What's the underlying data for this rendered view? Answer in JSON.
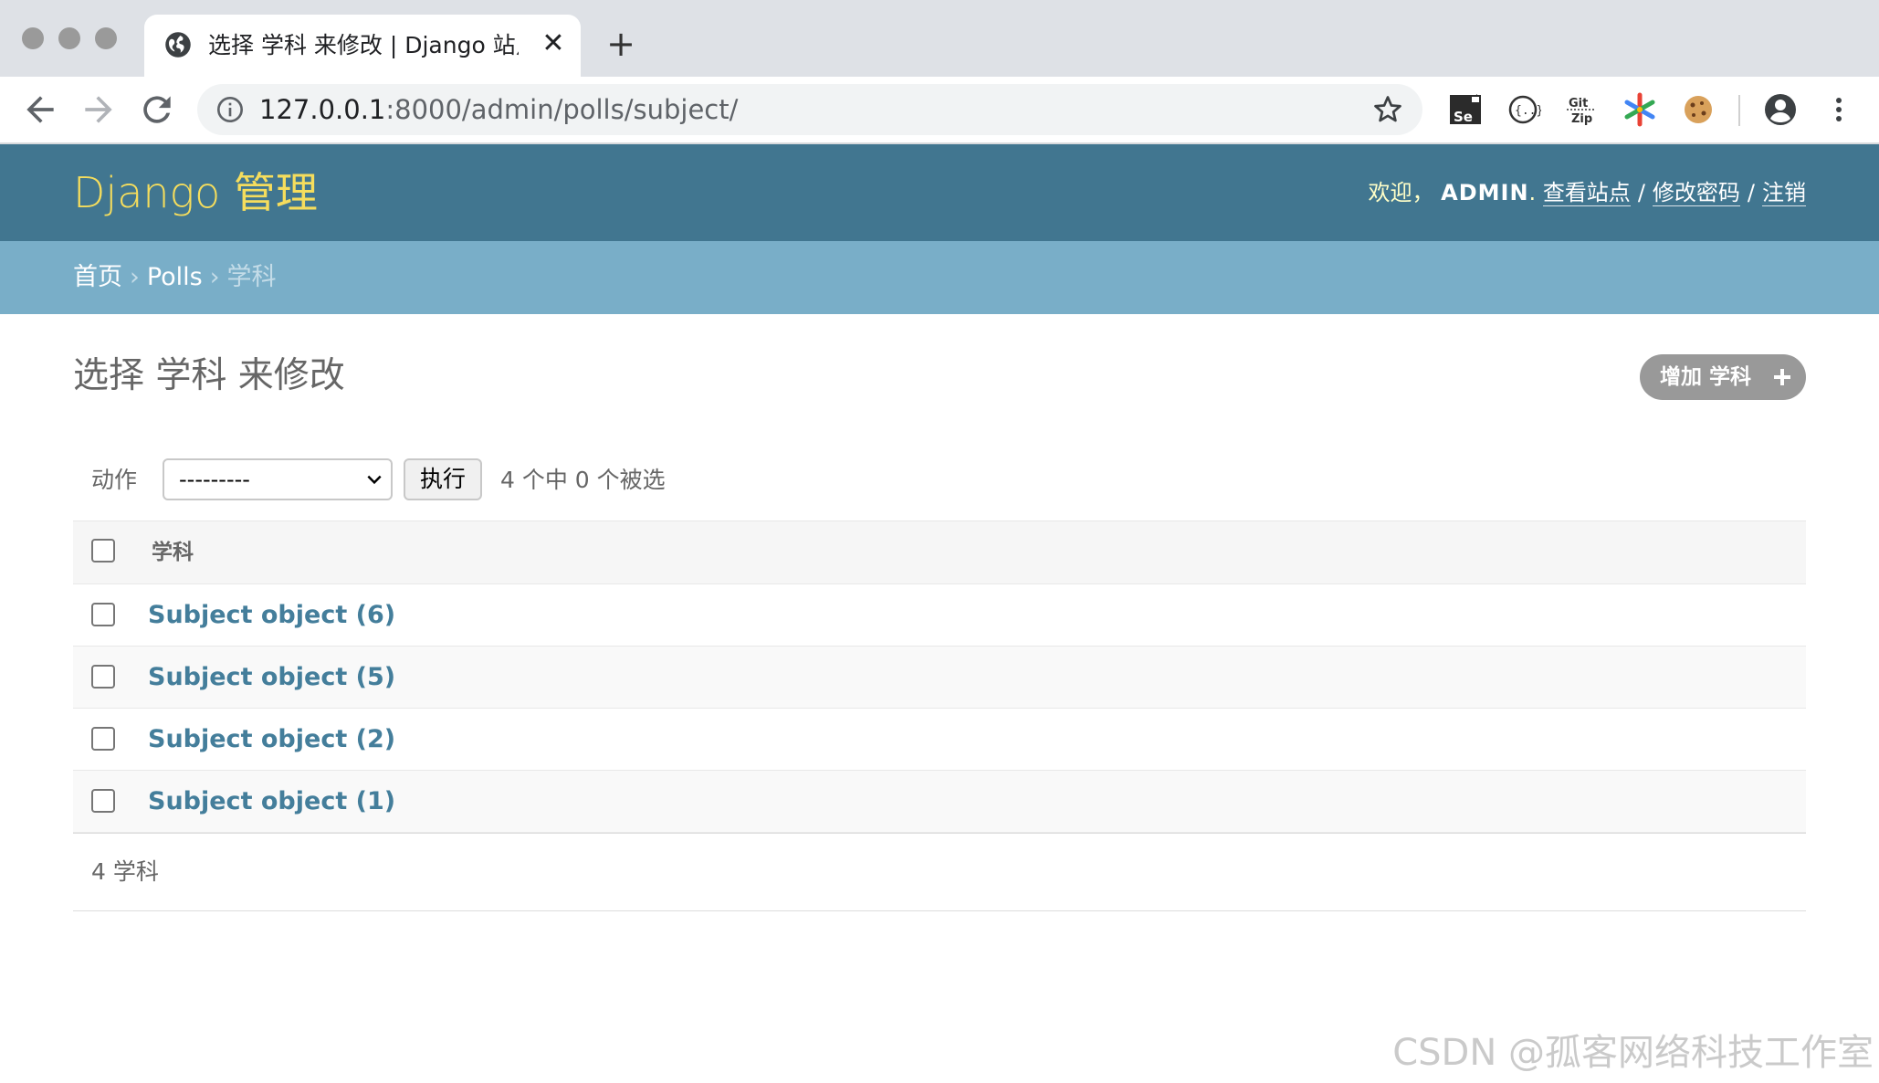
{
  "browser": {
    "tab_title": "选择 学科 来修改 | Django 站点管理",
    "tab_close": "✕",
    "new_tab": "+",
    "url_host": "127.0.0.1",
    "url_path": ":8000/admin/polls/subject/",
    "extensions": [
      "selenium-ide-icon",
      "json-formatter-icon",
      "gitzip-icon",
      "tab-extension-icon",
      "cookie-icon"
    ]
  },
  "header": {
    "brand": "Django 管理",
    "welcome": "欢迎，",
    "username": "ADMIN",
    "view_site": "查看站点",
    "change_password": "修改密码",
    "logout": "注销"
  },
  "breadcrumbs": {
    "home": "首页",
    "app": "Polls",
    "current": "学科"
  },
  "main": {
    "title": "选择 学科 来修改",
    "add_button": "增加 学科",
    "action_label": "动作",
    "action_select_value": "---------",
    "go_button": "执行",
    "selection_counter": "4 个中 0 个被选",
    "column_header": "学科",
    "rows": [
      {
        "label": "Subject object (6)"
      },
      {
        "label": "Subject object (5)"
      },
      {
        "label": "Subject object (2)"
      },
      {
        "label": "Subject object (1)"
      }
    ],
    "paginator": "4 学科"
  },
  "colors": {
    "header_bg": "#417690",
    "breadcrumb_bg": "#79aec8",
    "brand_text": "#f5dd5d",
    "link": "#447e9b",
    "add_button_bg": "#999999"
  },
  "watermark": "CSDN @孤客网络科技工作室"
}
